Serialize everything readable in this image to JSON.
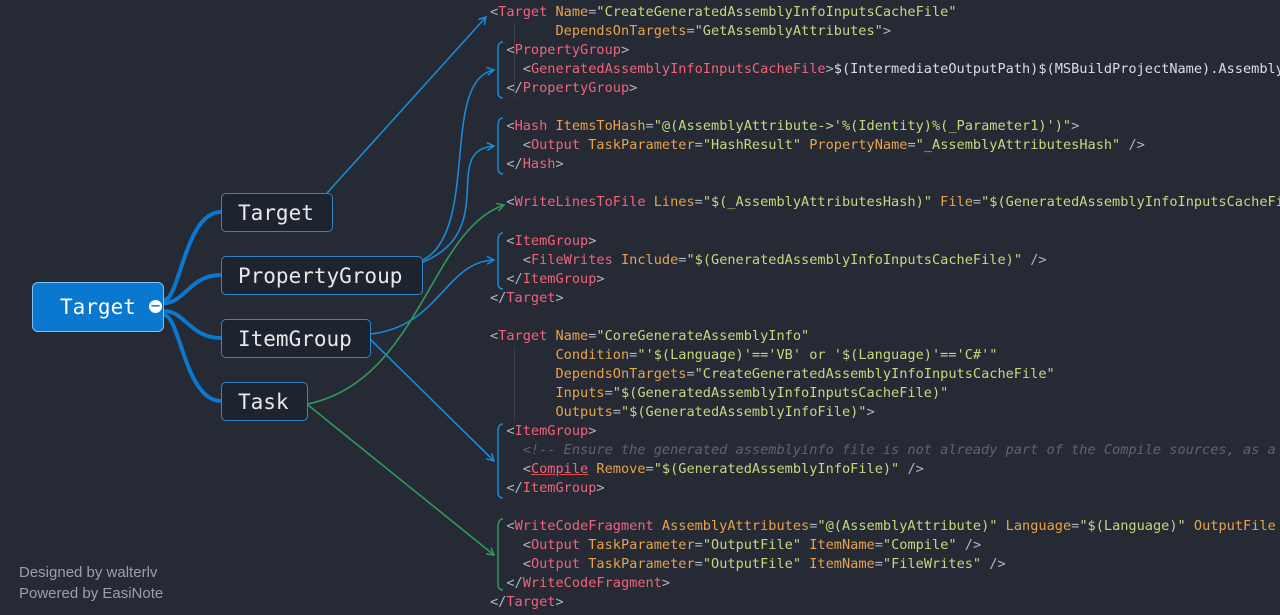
{
  "mindmap": {
    "root": "Target",
    "branches": [
      "Target",
      "PropertyGroup",
      "ItemGroup",
      "Task"
    ]
  },
  "colors": {
    "blue_link": "#1a8ad8",
    "green_link": "#2e9b58",
    "root_fill": "#0a78cf",
    "tag": "#f1637a",
    "attribute": "#e8a34b",
    "value": "#c6d87f",
    "comment": "#5d6472"
  },
  "code_lines": [
    [
      [
        "p",
        "<"
      ],
      [
        "t",
        "Target"
      ],
      [
        "x",
        " "
      ],
      [
        "a",
        "Name"
      ],
      [
        "p",
        "="
      ],
      [
        "v",
        "\"CreateGeneratedAssemblyInfoInputsCacheFile\""
      ]
    ],
    [
      [
        "x",
        "        "
      ],
      [
        "a",
        "DependsOnTargets"
      ],
      [
        "p",
        "="
      ],
      [
        "v",
        "\"GetAssemblyAttributes\""
      ],
      [
        "p",
        ">"
      ]
    ],
    [
      [
        "x",
        "  "
      ],
      [
        "p",
        "<"
      ],
      [
        "t",
        "PropertyGroup"
      ],
      [
        "p",
        ">"
      ]
    ],
    [
      [
        "x",
        "    "
      ],
      [
        "p",
        "<"
      ],
      [
        "t",
        "GeneratedAssemblyInfoInputsCacheFile"
      ],
      [
        "p",
        ">"
      ],
      [
        "x",
        "$(IntermediateOutputPath)$(MSBuildProjectName).AssemblyInfoInputs.cache"
      ]
    ],
    [
      [
        "x",
        "  "
      ],
      [
        "p",
        "</"
      ],
      [
        "t",
        "PropertyGroup"
      ],
      [
        "p",
        ">"
      ]
    ],
    [],
    [
      [
        "x",
        "  "
      ],
      [
        "p",
        "<"
      ],
      [
        "t",
        "Hash"
      ],
      [
        "x",
        " "
      ],
      [
        "a",
        "ItemsToHash"
      ],
      [
        "p",
        "="
      ],
      [
        "v",
        "\"@(AssemblyAttribute->'%(Identity)%(_Parameter1)')\""
      ],
      [
        "p",
        ">"
      ]
    ],
    [
      [
        "x",
        "    "
      ],
      [
        "p",
        "<"
      ],
      [
        "t",
        "Output"
      ],
      [
        "x",
        " "
      ],
      [
        "a",
        "TaskParameter"
      ],
      [
        "p",
        "="
      ],
      [
        "v",
        "\"HashResult\""
      ],
      [
        "x",
        " "
      ],
      [
        "a",
        "PropertyName"
      ],
      [
        "p",
        "="
      ],
      [
        "v",
        "\"_AssemblyAttributesHash\""
      ],
      [
        "x",
        " "
      ],
      [
        "p",
        "/>"
      ]
    ],
    [
      [
        "x",
        "  "
      ],
      [
        "p",
        "</"
      ],
      [
        "t",
        "Hash"
      ],
      [
        "p",
        ">"
      ]
    ],
    [],
    [
      [
        "x",
        "  "
      ],
      [
        "p",
        "<"
      ],
      [
        "t",
        "WriteLinesToFile"
      ],
      [
        "x",
        " "
      ],
      [
        "a",
        "Lines"
      ],
      [
        "p",
        "="
      ],
      [
        "v",
        "\"$(_AssemblyAttributesHash)\""
      ],
      [
        "x",
        " "
      ],
      [
        "a",
        "File"
      ],
      [
        "p",
        "="
      ],
      [
        "v",
        "\"$(GeneratedAssemblyInfoInputsCacheFile)\""
      ]
    ],
    [],
    [
      [
        "x",
        "  "
      ],
      [
        "p",
        "<"
      ],
      [
        "t",
        "ItemGroup"
      ],
      [
        "p",
        ">"
      ]
    ],
    [
      [
        "x",
        "    "
      ],
      [
        "p",
        "<"
      ],
      [
        "t",
        "FileWrites"
      ],
      [
        "x",
        " "
      ],
      [
        "a",
        "Include"
      ],
      [
        "p",
        "="
      ],
      [
        "v",
        "\"$(GeneratedAssemblyInfoInputsCacheFile)\""
      ],
      [
        "x",
        " "
      ],
      [
        "p",
        "/>"
      ]
    ],
    [
      [
        "x",
        "  "
      ],
      [
        "p",
        "</"
      ],
      [
        "t",
        "ItemGroup"
      ],
      [
        "p",
        ">"
      ]
    ],
    [
      [
        "p",
        "</"
      ],
      [
        "t",
        "Target"
      ],
      [
        "p",
        ">"
      ]
    ],
    [],
    [
      [
        "p",
        "<"
      ],
      [
        "t",
        "Target"
      ],
      [
        "x",
        " "
      ],
      [
        "a",
        "Name"
      ],
      [
        "p",
        "="
      ],
      [
        "v",
        "\"CoreGenerateAssemblyInfo\""
      ]
    ],
    [
      [
        "x",
        "        "
      ],
      [
        "a",
        "Condition"
      ],
      [
        "p",
        "="
      ],
      [
        "v",
        "\"'$(Language)'=='VB' or '$(Language)'=='C#'\""
      ]
    ],
    [
      [
        "x",
        "        "
      ],
      [
        "a",
        "DependsOnTargets"
      ],
      [
        "p",
        "="
      ],
      [
        "v",
        "\"CreateGeneratedAssemblyInfoInputsCacheFile\""
      ]
    ],
    [
      [
        "x",
        "        "
      ],
      [
        "a",
        "Inputs"
      ],
      [
        "p",
        "="
      ],
      [
        "v",
        "\"$(GeneratedAssemblyInfoInputsCacheFile)\""
      ]
    ],
    [
      [
        "x",
        "        "
      ],
      [
        "a",
        "Outputs"
      ],
      [
        "p",
        "="
      ],
      [
        "v",
        "\"$(GeneratedAssemblyInfoFile)\""
      ],
      [
        "p",
        ">"
      ]
    ],
    [
      [
        "x",
        "  "
      ],
      [
        "p",
        "<"
      ],
      [
        "t",
        "ItemGroup"
      ],
      [
        "p",
        ">"
      ]
    ],
    [
      [
        "x",
        "    "
      ],
      [
        "c",
        "<!-- Ensure the generated assemblyinfo file is not already part of the Compile sources, as a"
      ]
    ],
    [
      [
        "x",
        "    "
      ],
      [
        "p",
        "<"
      ],
      [
        "u",
        "Compile"
      ],
      [
        "x",
        " "
      ],
      [
        "a",
        "Remove"
      ],
      [
        "p",
        "="
      ],
      [
        "v",
        "\"$(GeneratedAssemblyInfoFile)\""
      ],
      [
        "x",
        " "
      ],
      [
        "p",
        "/>"
      ]
    ],
    [
      [
        "x",
        "  "
      ],
      [
        "p",
        "</"
      ],
      [
        "t",
        "ItemGroup"
      ],
      [
        "p",
        ">"
      ]
    ],
    [],
    [
      [
        "x",
        "  "
      ],
      [
        "p",
        "<"
      ],
      [
        "t",
        "WriteCodeFragment"
      ],
      [
        "x",
        " "
      ],
      [
        "a",
        "AssemblyAttributes"
      ],
      [
        "p",
        "="
      ],
      [
        "v",
        "\"@(AssemblyAttribute)\""
      ],
      [
        "x",
        " "
      ],
      [
        "a",
        "Language"
      ],
      [
        "p",
        "="
      ],
      [
        "v",
        "\"$(Language)\""
      ],
      [
        "x",
        " "
      ],
      [
        "a",
        "OutputFile"
      ]
    ],
    [
      [
        "x",
        "    "
      ],
      [
        "p",
        "<"
      ],
      [
        "t",
        "Output"
      ],
      [
        "x",
        " "
      ],
      [
        "a",
        "TaskParameter"
      ],
      [
        "p",
        "="
      ],
      [
        "v",
        "\"OutputFile\""
      ],
      [
        "x",
        " "
      ],
      [
        "a",
        "ItemName"
      ],
      [
        "p",
        "="
      ],
      [
        "v",
        "\"Compile\""
      ],
      [
        "x",
        " "
      ],
      [
        "p",
        "/>"
      ]
    ],
    [
      [
        "x",
        "    "
      ],
      [
        "p",
        "<"
      ],
      [
        "t",
        "Output"
      ],
      [
        "x",
        " "
      ],
      [
        "a",
        "TaskParameter"
      ],
      [
        "p",
        "="
      ],
      [
        "v",
        "\"OutputFile\""
      ],
      [
        "x",
        " "
      ],
      [
        "a",
        "ItemName"
      ],
      [
        "p",
        "="
      ],
      [
        "v",
        "\"FileWrites\""
      ],
      [
        "x",
        " "
      ],
      [
        "p",
        "/>"
      ]
    ],
    [
      [
        "x",
        "  "
      ],
      [
        "p",
        "</"
      ],
      [
        "t",
        "WriteCodeFragment"
      ],
      [
        "p",
        ">"
      ]
    ],
    [
      [
        "p",
        "</"
      ],
      [
        "t",
        "Target"
      ],
      [
        "p",
        ">"
      ]
    ]
  ],
  "footer": {
    "designed_by": "Designed by walterlv",
    "powered_by": "Powered by EasiNote"
  }
}
